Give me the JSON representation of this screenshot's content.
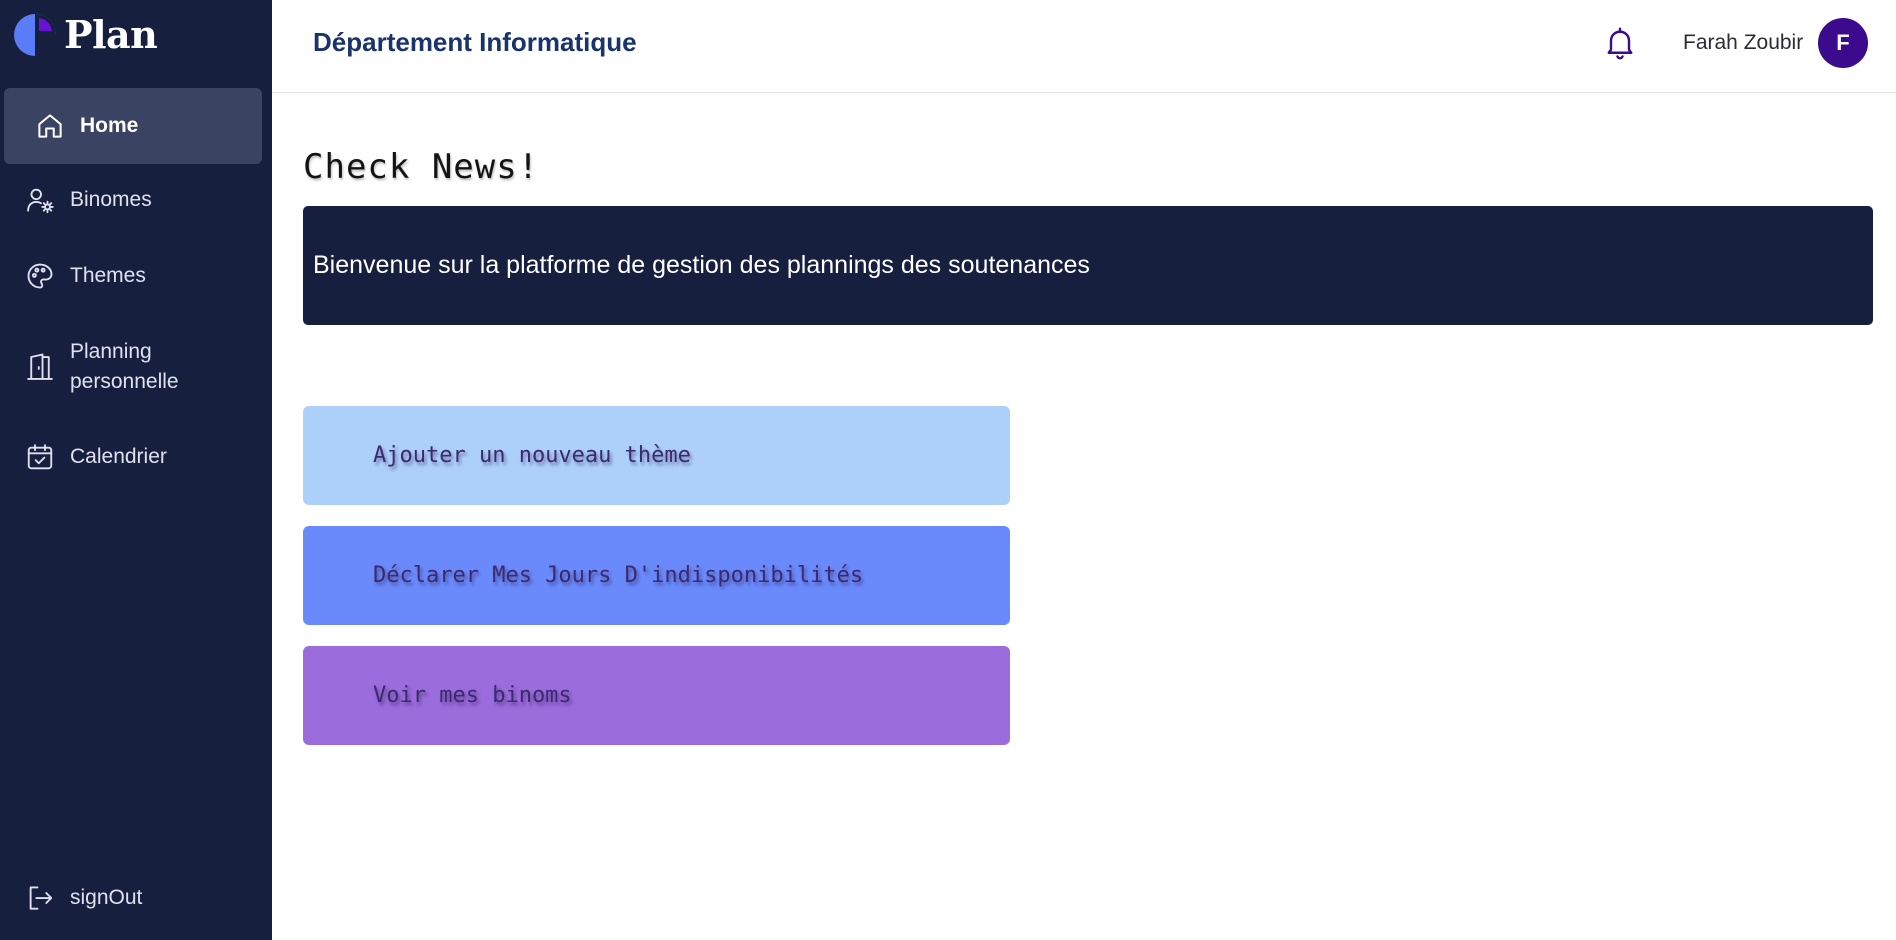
{
  "brand": {
    "name": "Plan"
  },
  "sidebar": {
    "items": [
      {
        "label": "Home",
        "icon": "home-icon",
        "active": true
      },
      {
        "label": "Binomes",
        "icon": "user-gear-icon"
      },
      {
        "label": "Themes",
        "icon": "palette-icon"
      },
      {
        "label": "Planning\npersonnelle",
        "icon": "door-icon"
      },
      {
        "label": "Calendrier",
        "icon": "calendar-check-icon"
      }
    ],
    "signout": {
      "label": "signOut",
      "icon": "sign-out-icon"
    }
  },
  "header": {
    "title": "Département Informatique",
    "bell_icon": "bell-icon",
    "user_name": "Farah Zoubir",
    "avatar_initial": "F"
  },
  "main": {
    "title": "Check News!",
    "news_text": "Bienvenue sur la platforme de gestion des plannings des soutenances",
    "actions": [
      {
        "label": "Ajouter un nouveau thème"
      },
      {
        "label": "Déclarer Mes Jours D'indisponibilités"
      },
      {
        "label": "Voir mes binoms"
      }
    ]
  },
  "colors": {
    "sidebar_bg": "#171f3f",
    "active_item_bg": "#3b4362",
    "header_title": "#19336b",
    "avatar_bg": "#3c0a8c",
    "news_bg": "#171f3f",
    "action_1": "#add0fb",
    "action_2": "#6a8afc",
    "action_3": "#9b6cdc"
  }
}
